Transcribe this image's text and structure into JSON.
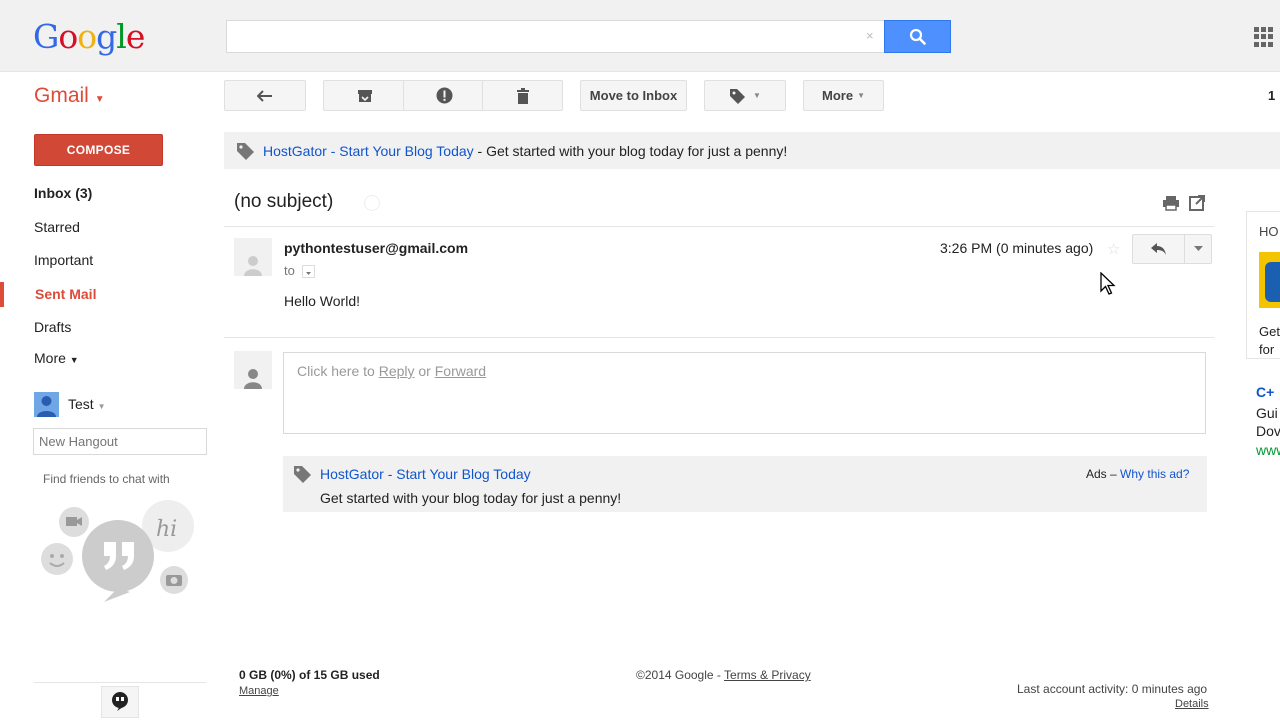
{
  "header": {
    "logo_letters": [
      "G",
      "o",
      "o",
      "g",
      "l",
      "e"
    ],
    "search_value": "",
    "search_clear": "×",
    "search_icon": "search-icon",
    "apps_icon": "apps-grid-icon"
  },
  "toolbar": {
    "gmail_label": "Gmail",
    "back_icon": "back-arrow-icon",
    "archive_icon": "archive-icon",
    "spam_icon": "report-spam-icon",
    "delete_icon": "trash-icon",
    "move_to_inbox": "Move to Inbox",
    "labels_icon": "label-icon",
    "more": "More",
    "page_count": "1"
  },
  "sidebar": {
    "compose": "COMPOSE",
    "items": [
      {
        "label": "Inbox (3)",
        "bold": true
      },
      {
        "label": "Starred"
      },
      {
        "label": "Important"
      },
      {
        "label": "Sent Mail",
        "active": true
      },
      {
        "label": "Drafts"
      },
      {
        "label": "More"
      }
    ],
    "hangouts": {
      "user": "Test",
      "new_hangout_placeholder": "New Hangout",
      "find_friends": "Find friends to chat with"
    }
  },
  "ad_top": {
    "title": "HostGator - Start Your Blog Today",
    "separator": " - ",
    "description": "Get started with your blog today for just a penny!"
  },
  "message": {
    "subject": "(no subject)",
    "sender": "pythontestuser@gmail.com",
    "to": "to",
    "time": "3:26 PM (0 minutes ago)",
    "body": "Hello World!"
  },
  "reply": {
    "prefix": "Click here to ",
    "reply": "Reply",
    "or": " or ",
    "forward": "Forward"
  },
  "ad_bottom": {
    "title": "HostGator - Start Your Blog Today",
    "description": "Get started with your blog today for just a penny!",
    "ads_label": "Ads – ",
    "why_this_ad": "Why this ad?"
  },
  "right_ads": {
    "label": "HO",
    "line1": "Get",
    "line2": "for ",
    "cpp_title": "C+",
    "line3": "Gui",
    "line4": "Dov",
    "line5": "www"
  },
  "footer": {
    "storage": "0 GB (0%) of 15 GB used",
    "manage": "Manage",
    "copyright": "©2014 Google - ",
    "terms": "Terms & Privacy",
    "last_activity": "Last account activity: 0 minutes ago",
    "details": "Details"
  },
  "colors": {
    "accent_red": "#dd4b39",
    "search_blue": "#4d90fe",
    "link_blue": "#1155cc"
  }
}
